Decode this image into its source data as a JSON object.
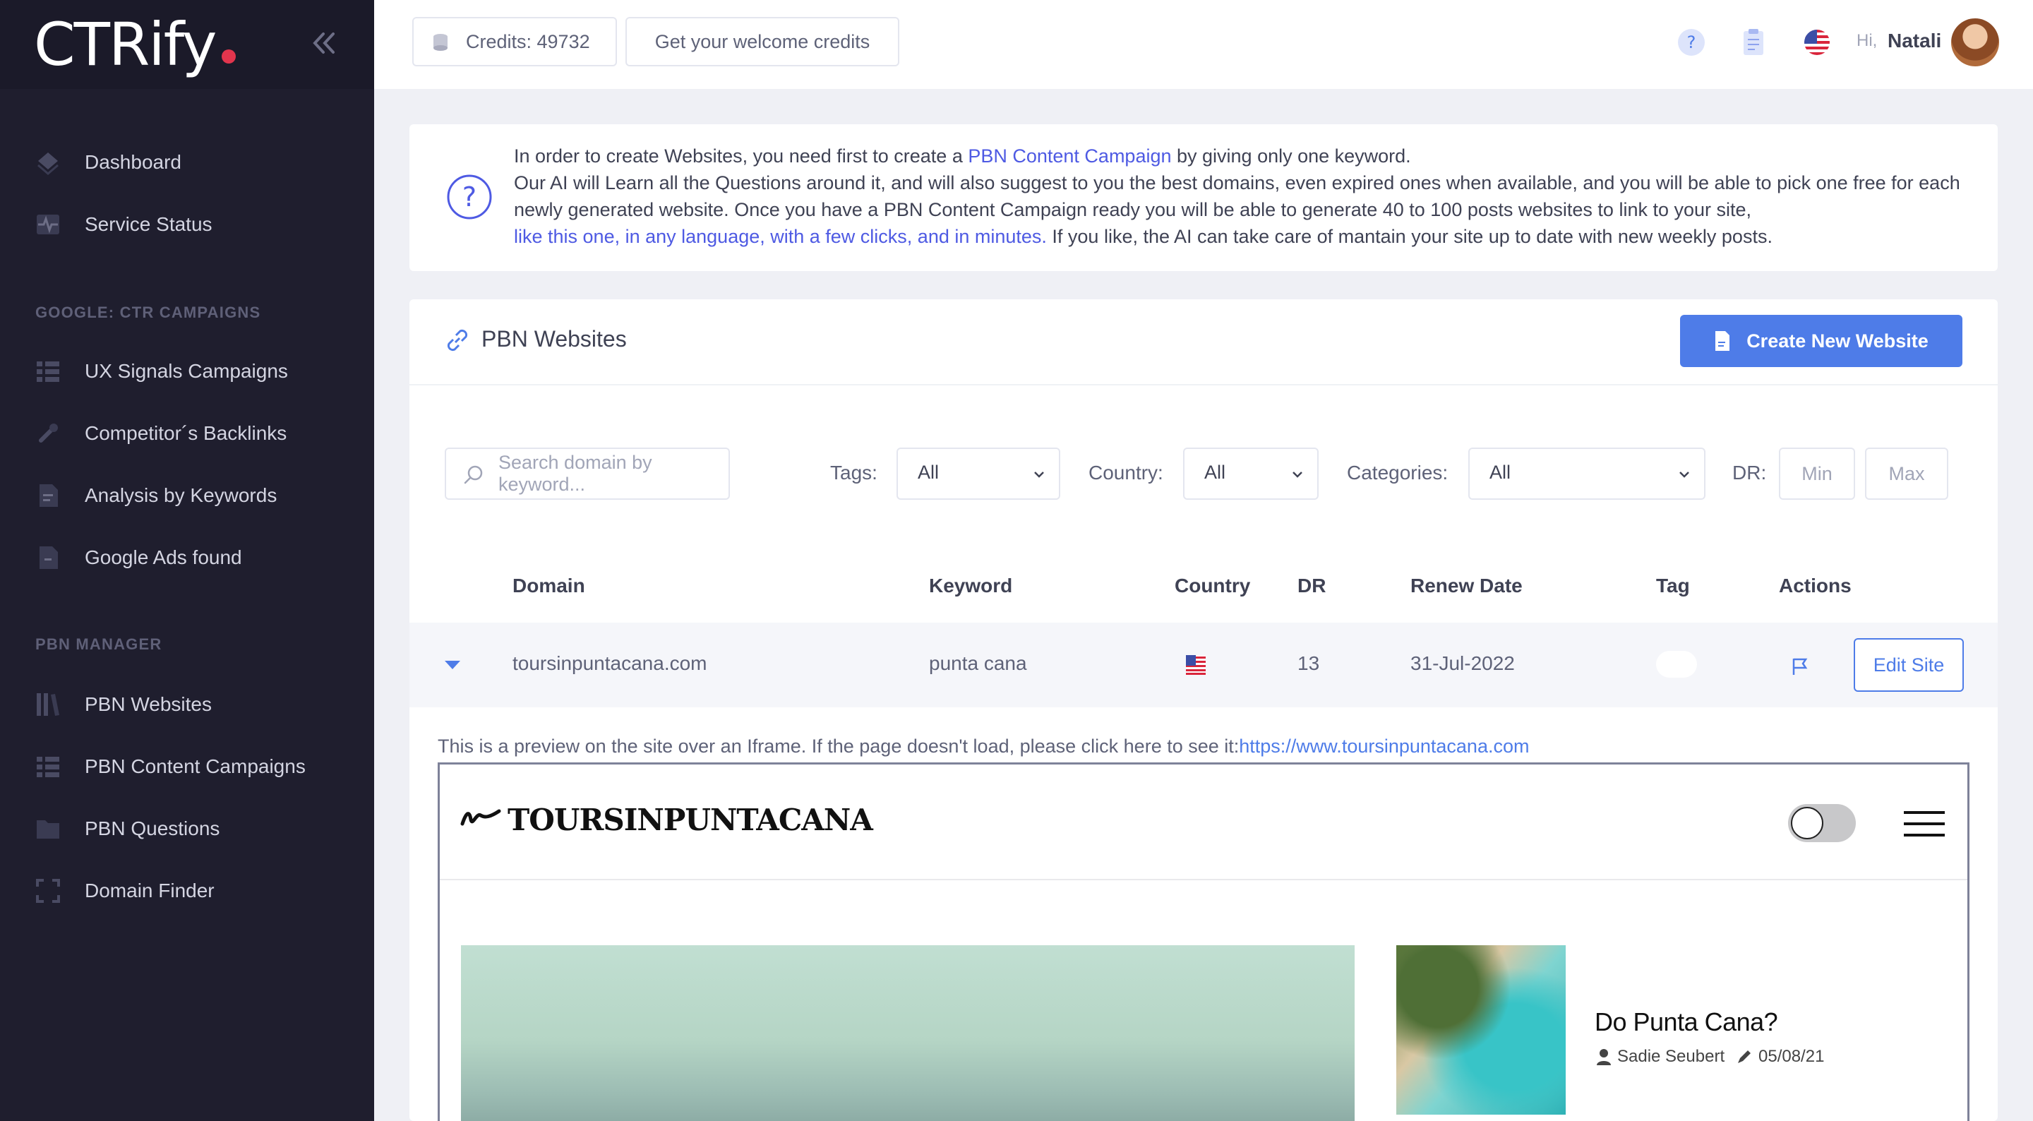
{
  "sidebar": {
    "logo": "CTRify",
    "items_top": [
      {
        "label": "Dashboard"
      },
      {
        "label": "Service Status"
      }
    ],
    "section_google": "GOOGLE: CTR CAMPAIGNS",
    "items_google": [
      {
        "label": "UX Signals Campaigns"
      },
      {
        "label": "Competitor´s Backlinks"
      },
      {
        "label": "Analysis by Keywords"
      },
      {
        "label": "Google Ads found"
      }
    ],
    "section_pbn": "PBN MANAGER",
    "items_pbn": [
      {
        "label": "PBN Websites"
      },
      {
        "label": "PBN Content Campaigns"
      },
      {
        "label": "PBN Questions"
      },
      {
        "label": "Domain Finder"
      }
    ]
  },
  "topbar": {
    "credits": "Credits: 49732",
    "welcome": "Get your welcome credits",
    "hi": "Hi,",
    "user": "Natali"
  },
  "info": {
    "line1_pre": "In order to create Websites, you need first to create a ",
    "line1_link": "PBN Content Campaign",
    "line1_post": " by giving only one keyword.",
    "line2": "Our AI will Learn all the Questions around it, and will also suggest to you the best domains, even expired ones when available, and you will be able to pick one free for each newly generated website. Once you have a PBN Content Campaign ready you will be able to generate 40 to 100 posts websites to link to your site,",
    "line3_link": "like this one, in any language, with a few clicks, and in minutes.",
    "line3_post": " If you like, the AI can take care of mantain your site up to date with new weekly posts."
  },
  "pbn": {
    "title": "PBN Websites",
    "create_btn": "Create New Website",
    "filters": {
      "search_placeholder": "Search domain by keyword...",
      "tags_label": "Tags:",
      "tags_value": "All",
      "country_label": "Country:",
      "country_value": "All",
      "categories_label": "Categories:",
      "categories_value": "All",
      "dr_label": "DR:",
      "min_placeholder": "Min",
      "max_placeholder": "Max"
    },
    "columns": [
      "Domain",
      "Keyword",
      "Country",
      "DR",
      "Renew Date",
      "Tag",
      "Actions"
    ],
    "rows": [
      {
        "domain": "toursinpuntacana.com",
        "keyword": "punta cana",
        "country": "us-flag",
        "dr": "13",
        "renew": "31-Jul-2022",
        "action": "Edit Site"
      }
    ],
    "preview_note": "This is a preview on the site over an Iframe. If the page doesn't load, please click here to see it:",
    "preview_url": "https://www.toursinpuntacana.com"
  },
  "site_preview": {
    "logo": "TOURSINPUNTACANA",
    "post_title": "Do Punta Cana?",
    "author": "Sadie Seubert",
    "date": "05/08/21"
  },
  "colors": {
    "sidebar_bg": "#1f1e2e",
    "primary": "#4e7ce8",
    "link": "#4e5ae3",
    "logo_dot": "#e2354d"
  }
}
